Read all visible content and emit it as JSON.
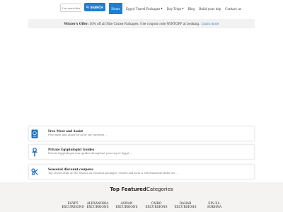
{
  "header": {
    "search_placeholder": "I'm searching",
    "search_button": "SEARCH",
    "nav": [
      {
        "label": "Home",
        "active": true,
        "dropdown": false
      },
      {
        "label": "Egypt Travel Packages",
        "active": false,
        "dropdown": true
      },
      {
        "label": "Day Trips",
        "active": false,
        "dropdown": true
      },
      {
        "label": "Blog",
        "active": false,
        "dropdown": false
      },
      {
        "label": "Build your trip",
        "active": false,
        "dropdown": false
      },
      {
        "label": "Contact us",
        "active": false,
        "dropdown": false
      }
    ]
  },
  "offer": {
    "title": "Winter's Offer:",
    "text": "10% off all Nile Cruise Packages. Use coupon code WINTOFF at booking.",
    "link": "Learn more"
  },
  "features": [
    {
      "icon": "passport-icon",
      "title": "Free Meet and Assist",
      "desc": "Free meet and assist for all of our travelers ..."
    },
    {
      "icon": "ankh-icon",
      "title": "Private Egyptologist Guides",
      "desc": "Private Egyptologist tour guides throughout your trip to Egypt ..."
    },
    {
      "icon": "discount-icon",
      "title": "Seasonal discount coupons",
      "desc": "Top Travel deals of The Season on vacation packages, cruises and local & entertainment deals too ..."
    }
  ],
  "featured": {
    "title_bold": "Top Featured",
    "title_rest": "Categories",
    "categories": [
      {
        "line1": "EGYPT",
        "line2": "EXCURSIONS"
      },
      {
        "line1": "ALEXANDRIA",
        "line2": "EXCURSIONS"
      },
      {
        "line1": "ASWAN",
        "line2": "EXCURSIONS"
      },
      {
        "line1": "CAIRO",
        "line2": "EXCURSIONS"
      },
      {
        "line1": "DAHAB",
        "line2": "EXCURSIONS"
      },
      {
        "line1": "EIN EL-",
        "line2": "SOKHNA"
      }
    ]
  },
  "colors": {
    "accent": "#1e7fd1",
    "icon": "#1a6fc4"
  }
}
